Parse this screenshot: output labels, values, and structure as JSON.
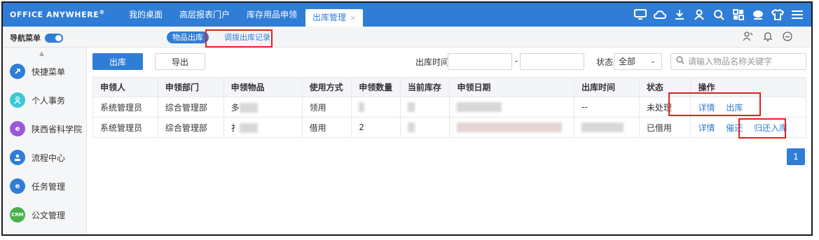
{
  "app": {
    "logo": "OFFICE ANYWHERE",
    "logo_mark": "®"
  },
  "tabs": [
    {
      "label": "我的桌面"
    },
    {
      "label": "高层报表门户"
    },
    {
      "label": "库存用品申领"
    },
    {
      "label": "出库管理",
      "active": true,
      "close": "×"
    }
  ],
  "top_icons": [
    "monitor-icon",
    "cloud-icon",
    "download-icon",
    "user-icon",
    "search-icon",
    "apps-icon",
    "chat-icon",
    "shirt-icon",
    "menu-icon"
  ],
  "subbar": {
    "nav_label": "导航菜单",
    "nav_toggle_on": true,
    "pill_active": "物品出库",
    "pill_link": "调拨出库记录"
  },
  "sidebar": {
    "items": [
      {
        "label": "快捷菜单",
        "icon": "shortcut-icon",
        "color": "#2f7dd6"
      },
      {
        "label": "个人事务",
        "icon": "person-icon",
        "color": "#3cc9d6"
      },
      {
        "label": "陕西省科学院",
        "icon": "ie-icon",
        "color": "#9b59d9"
      },
      {
        "label": "流程中心",
        "icon": "workflow-icon",
        "color": "#2f7dd6"
      },
      {
        "label": "任务管理",
        "icon": "ie-icon",
        "color": "#2f7dd6"
      },
      {
        "label": "公文管理",
        "icon": "crm-icon",
        "color": "#4cb04c",
        "badge": "CRM"
      }
    ]
  },
  "toolbar": {
    "outbound_btn": "出库",
    "export_btn": "导出",
    "time_label": "出库时间:",
    "time_sep": "-",
    "status_label": "状态:",
    "status_value": "全部",
    "search_placeholder": "请输入物品名称关键字"
  },
  "table": {
    "headers": [
      "申领人",
      "申领部门",
      "申领物品",
      "使用方式",
      "申领数量",
      "当前库存",
      "申领日期",
      "出库时间",
      "状态",
      "操作"
    ],
    "rows": [
      {
        "applicant": "系统管理员",
        "dept": "综合管理部",
        "item": "多",
        "usage": "领用",
        "qty": "",
        "stock": "",
        "date": "",
        "out_time": "--",
        "status": "未处理",
        "actions": [
          "详情",
          "出库"
        ]
      },
      {
        "applicant": "系统管理员",
        "dept": "综合管理部",
        "item": "扌",
        "usage": "借用",
        "qty": "2",
        "stock": "",
        "date": "",
        "out_time": "",
        "status": "已借用",
        "actions": [
          "详情",
          "催还",
          "归还入库"
        ]
      }
    ]
  },
  "pagination": {
    "current": "1"
  },
  "colors": {
    "primary": "#2f7dd6",
    "highlight": "#e02020"
  }
}
